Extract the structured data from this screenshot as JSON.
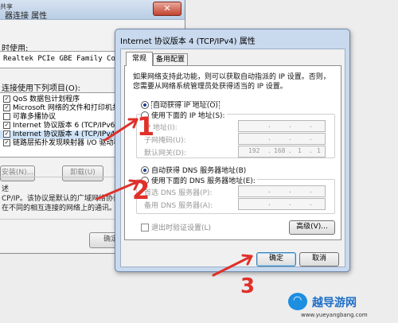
{
  "background_dialog": {
    "title_fragment": "器连接 属性",
    "tab_fragment": "共享",
    "connect_using_label": "时使用:",
    "adapter": "Realtek PCIe GBE Family Controlle",
    "items_label": "连接使用下列项目(O):",
    "items": [
      {
        "label": "QoS 数据包计划程序",
        "checked": true
      },
      {
        "label": "Microsoft 网络的文件和打印机共享",
        "checked": true
      },
      {
        "label": "可靠多播协议",
        "checked": false
      },
      {
        "label": "Internet 协议版本 6 (TCP/IPv6)",
        "checked": true
      },
      {
        "label": "Internet 协议版本 4 (TCP/IPv4)",
        "checked": true
      },
      {
        "label": "链路层拓扑发现映射器 I/O 驱动程序",
        "checked": true
      }
    ],
    "install_button": "安装(N)...",
    "uninstall_button": "卸载(U)",
    "description_heading": "述",
    "description_lines": [
      "CP/IP。该协议是默认的广域网络协议，",
      "在不同的相互连接的网络上的通讯。"
    ],
    "ok_button": "确定"
  },
  "dialog": {
    "title": "Internet 协议版本 4 (TCP/IPv4) 属性",
    "tabs": [
      "常规",
      "备用配置"
    ],
    "description": [
      "如果网络支持此功能，则可以获取自动指派的 IP 设置。否则，",
      "您需要从网络系统管理员处获得适当的 IP 设置。"
    ],
    "ip_auto_label": "自动获得 IP 地址(O)",
    "ip_manual_label": "使用下面的 IP 地址(S):",
    "ip_address_label": "IP 地址(I):",
    "subnet_label": "子网掩码(U):",
    "gateway_label": "默认网关(D):",
    "gateway_value": [
      "192",
      "168",
      "1",
      "1"
    ],
    "dns_auto_label": "自动获得 DNS 服务器地址(B)",
    "dns_manual_label": "使用下面的 DNS 服务器地址(E):",
    "dns_preferred_label": "首选 DNS 服务器(P):",
    "dns_alternate_label": "备用 DNS 服务器(A):",
    "validate_label": "退出时验证设置(L)",
    "advanced_button": "高级(V)...",
    "ok_button": "确定",
    "cancel_button": "取消"
  },
  "annotations": {
    "numbers": [
      "1",
      "2",
      "3"
    ],
    "arrow_color": "#e0302a"
  },
  "watermark": {
    "brand": "越导游网",
    "url": "www.yueyangbang.com"
  }
}
